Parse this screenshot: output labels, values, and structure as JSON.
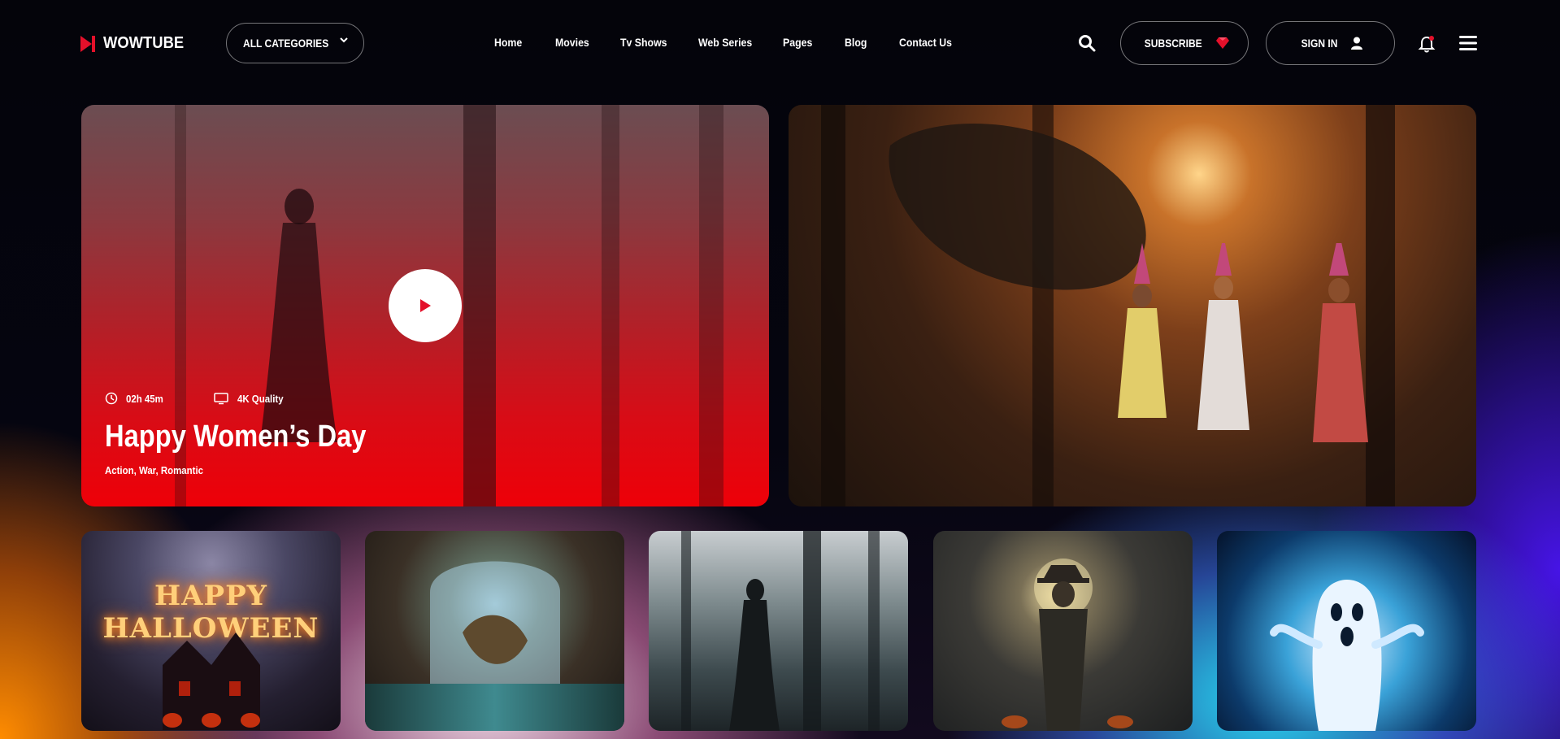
{
  "brand": {
    "name": "WOWTUBE"
  },
  "header": {
    "categories_label": "ALL CATEGORIES",
    "nav": [
      "Home",
      "Movies",
      "Tv Shows",
      "Web Series",
      "Pages",
      "Blog",
      "Contact Us"
    ],
    "subscribe_label": "SUBSCRIBE",
    "signin_label": "SIGN IN"
  },
  "featured": {
    "duration": "02h 45m",
    "quality": "4K Quality",
    "title": "Happy Women’s Day",
    "genres": "Action, War, Romantic"
  },
  "thumbnails": {
    "t0_text": "HAPPY HALLOWEEN"
  },
  "colors": {
    "accent": "#e4102a",
    "hero_red": "#ee0008"
  }
}
